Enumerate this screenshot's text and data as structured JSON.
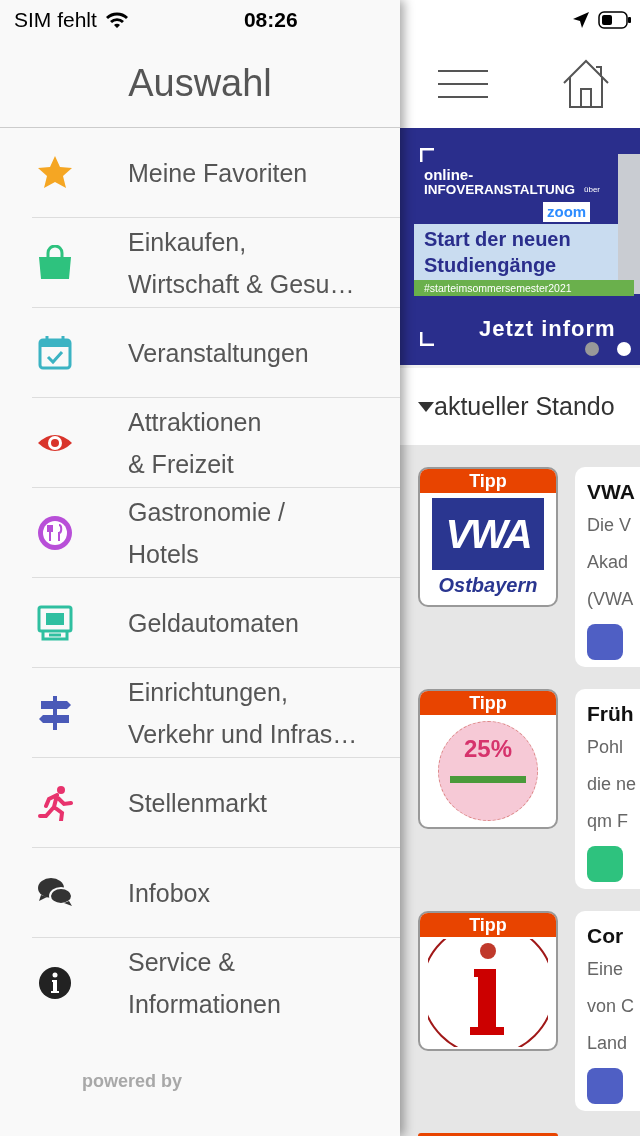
{
  "status_bar": {
    "carrier": "SIM fehlt",
    "time": "08:26"
  },
  "drawer": {
    "title": "Auswahl",
    "items": [
      {
        "lines": [
          "Meine Favoriten"
        ]
      },
      {
        "lines": [
          "Einkaufen,",
          "Wirtschaft & Gesu…"
        ]
      },
      {
        "lines": [
          "Veranstaltungen"
        ]
      },
      {
        "lines": [
          "Attraktionen",
          "& Freizeit"
        ]
      },
      {
        "lines": [
          "Gastronomie /",
          "Hotels"
        ]
      },
      {
        "lines": [
          "Geldautomaten"
        ]
      },
      {
        "lines": [
          "Einrichtungen,",
          "Verkehr und Infras…"
        ]
      },
      {
        "lines": [
          "Stellenmarkt"
        ]
      },
      {
        "lines": [
          "Infobox"
        ]
      },
      {
        "lines": [
          "Service &",
          "Informationen"
        ]
      }
    ],
    "footer": "powered by"
  },
  "banner": {
    "kicker": "online-",
    "headline": "INFOVERANSTALTUNG",
    "via": "über",
    "platform": "zoom",
    "title_lines": [
      "Start der neuen",
      "Studiengänge"
    ],
    "hashtag": "#starteimsommersemester2021",
    "cta": "Jetzt inform",
    "slides": [
      {
        "selected": false
      },
      {
        "selected": true
      }
    ]
  },
  "section": {
    "title": "aktueller Stando",
    "expanded": true
  },
  "entries": [
    {
      "badge": "Tipp",
      "thumb": {
        "kind": "logo",
        "texts": [
          "VWA",
          "Ostbayern"
        ]
      },
      "title": "VWA",
      "lines": [
        "Die V",
        "Akad",
        "(VWA"
      ],
      "color": "#4f5fc4"
    },
    {
      "badge": "Tipp",
      "thumb": {
        "kind": "coupon",
        "texts": [
          "25%"
        ]
      },
      "title": "Früh",
      "lines": [
        "Pohl",
        "die ne",
        "qm F"
      ],
      "color": "#2ec27e"
    },
    {
      "badge": "Tipp",
      "thumb": {
        "kind": "info"
      },
      "title": "Cor",
      "lines": [
        "Eine",
        "von C",
        "Land"
      ],
      "color": "#4f5fc4"
    }
  ]
}
